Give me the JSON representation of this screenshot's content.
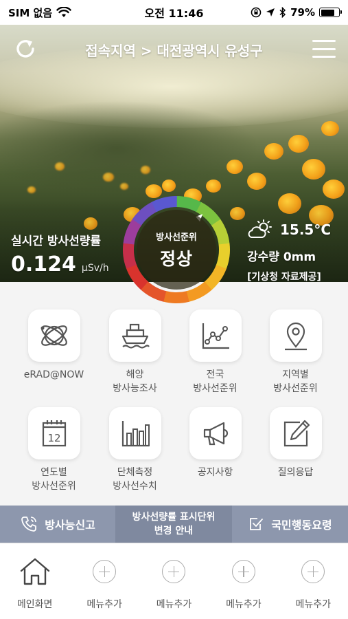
{
  "status_bar": {
    "carrier": "SIM 없음",
    "time": "오전 11:46",
    "battery": "79%",
    "battery_level": 0.79
  },
  "header": {
    "location": "접속지역 > 대전광역시 유성구"
  },
  "realtime": {
    "label": "실시간 방사선량률",
    "value": "0.124",
    "unit": "µSv/h"
  },
  "gauge": {
    "label": "방사선준위",
    "status": "정상"
  },
  "weather": {
    "temperature": "15.5°C",
    "rainfall": "강수량 0mm",
    "source": "[기상청 자료제공]"
  },
  "menu_tiles": [
    {
      "label": "eRAD@NOW",
      "icon": "orbit-globe-icon"
    },
    {
      "label": "해양\n방사능조사",
      "icon": "ship-icon"
    },
    {
      "label": "전국\n방사선준위",
      "icon": "line-chart-icon"
    },
    {
      "label": "지역별\n방사선준위",
      "icon": "map-pin-icon"
    },
    {
      "label": "연도별\n방사선준위",
      "icon": "calendar-icon"
    },
    {
      "label": "단체측정\n방사선수치",
      "icon": "bar-chart-icon"
    },
    {
      "label": "공지사항",
      "icon": "megaphone-icon"
    },
    {
      "label": "질의응답",
      "icon": "edit-icon"
    }
  ],
  "calendar_day": "12",
  "info_bar": {
    "report": "방사능신고",
    "notice_line1": "방사선량률 표시단위",
    "notice_line2": "변경 안내",
    "action": "국민행동요령"
  },
  "tab_bar": [
    {
      "label": "메인화면",
      "icon": "home-icon"
    },
    {
      "label": "메뉴추가",
      "icon": "plus-circle-icon"
    },
    {
      "label": "메뉴추가",
      "icon": "plus-circle-icon"
    },
    {
      "label": "메뉴추가",
      "icon": "plus-circle-icon"
    },
    {
      "label": "메뉴추가",
      "icon": "plus-circle-icon"
    }
  ]
}
